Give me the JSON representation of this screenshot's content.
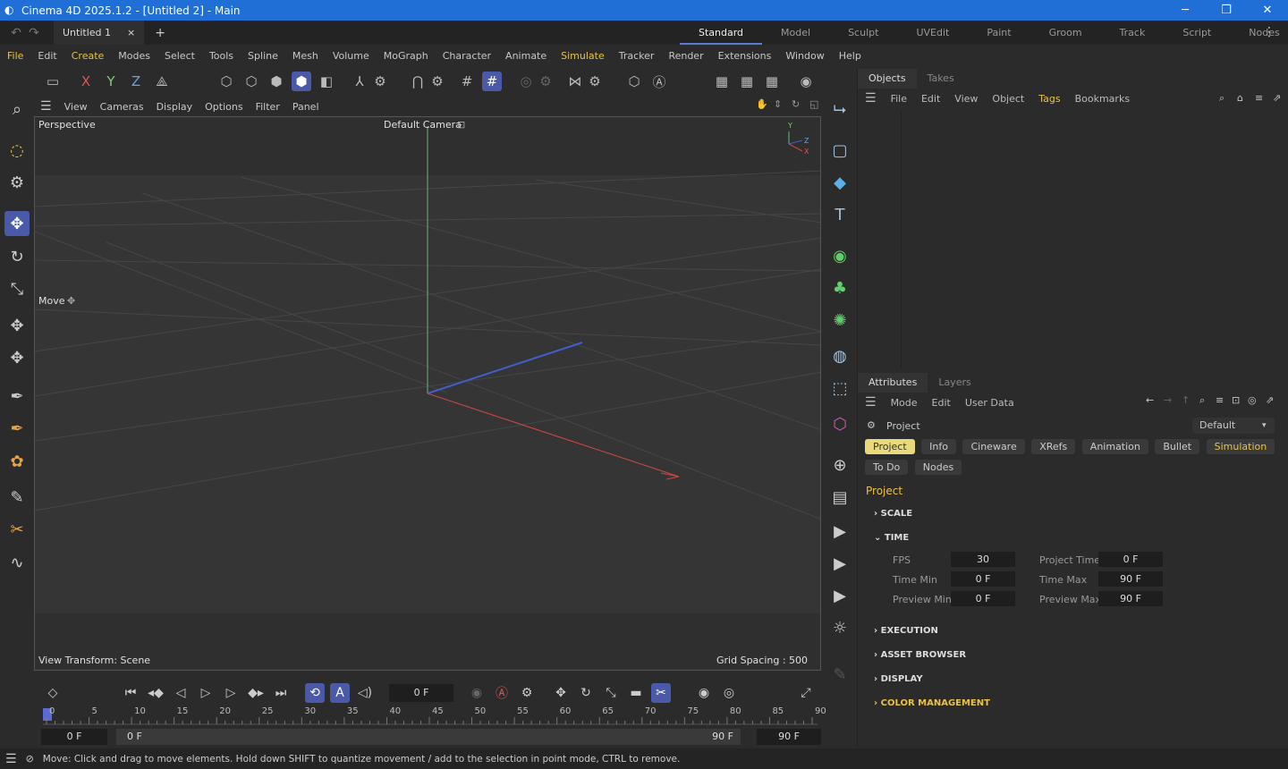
{
  "window": {
    "title": "Cinema 4D 2025.1.2 - [Untitled 2] - Main",
    "minimize": "─",
    "maximize": "❐",
    "close": "✕"
  },
  "tabs": {
    "doc": "Untitled 1",
    "close": "×",
    "add": "+",
    "layouts": [
      "Standard",
      "Model",
      "Sculpt",
      "UVEdit",
      "Paint",
      "Groom",
      "Track",
      "Script",
      "Nodes"
    ],
    "more": "⋮"
  },
  "menu": [
    "File",
    "Edit",
    "Create",
    "Modes",
    "Select",
    "Tools",
    "Spline",
    "Mesh",
    "Volume",
    "MoGraph",
    "Character",
    "Animate",
    "Simulate",
    "Tracker",
    "Render",
    "Extensions",
    "Window",
    "Help"
  ],
  "viewport": {
    "menu": [
      "View",
      "Cameras",
      "Display",
      "Options",
      "Filter",
      "Panel"
    ],
    "view": "Perspective",
    "camera": "Default Camera",
    "tool": "Move",
    "transform": "View Transform: Scene",
    "grid": "Grid Spacing : 500 cm",
    "axis_y": "Y",
    "axis_z": "Z",
    "axis_x": "X"
  },
  "objects": {
    "tabs": [
      "Objects",
      "Takes"
    ],
    "menu": [
      "File",
      "Edit",
      "View",
      "Object",
      "Tags",
      "Bookmarks"
    ]
  },
  "attributes": {
    "tabs": [
      "Attributes",
      "Layers"
    ],
    "menu": [
      "Mode",
      "Edit",
      "User Data"
    ],
    "object": "Project",
    "preset": "Default",
    "buttons": [
      "Project",
      "Info",
      "Cineware",
      "XRefs",
      "Animation",
      "Bullet",
      "Simulation",
      "To Do",
      "Nodes"
    ],
    "heading": "Project",
    "sections": {
      "scale": "SCALE",
      "time": "TIME",
      "execution": "EXECUTION",
      "asset": "ASSET BROWSER",
      "display": "DISPLAY",
      "color": "COLOR MANAGEMENT"
    },
    "fields": {
      "fps_l": "FPS",
      "fps": "30",
      "ptime_l": "Project Time",
      "ptime": "0 F",
      "tmin_l": "Time Min",
      "tmin": "0 F",
      "tmax_l": "Time Max",
      "tmax": "90 F",
      "pmin_l": "Preview Min",
      "pmin": "0 F",
      "pmax_l": "Preview Max",
      "pmax": "90 F"
    }
  },
  "timeline": {
    "frame": "0 F",
    "ticks": [
      "0",
      "5",
      "10",
      "15",
      "20",
      "25",
      "30",
      "35",
      "40",
      "45",
      "50",
      "55",
      "60",
      "65",
      "70",
      "75",
      "80",
      "85",
      "90"
    ],
    "start": "0 F",
    "range_start": "0 F",
    "range_end": "90 F",
    "end": "90 F"
  },
  "status": "Move: Click and drag to move elements. Hold down SHIFT to quantize movement / add to the selection in point mode, CTRL to remove."
}
